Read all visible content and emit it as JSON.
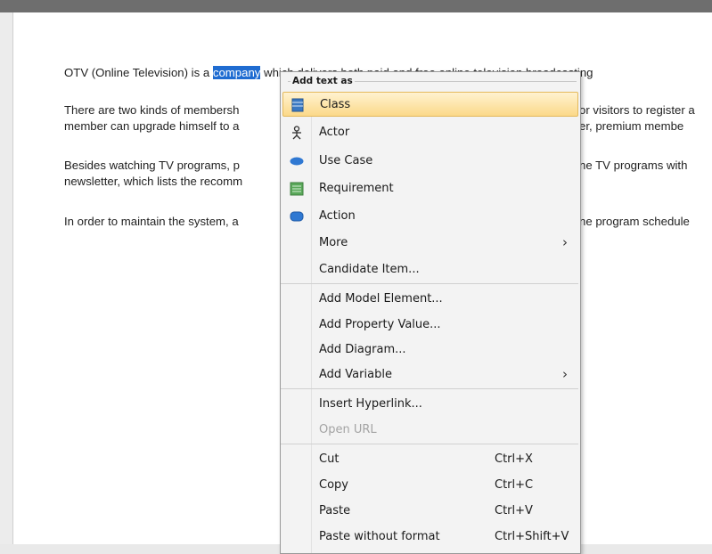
{
  "document": {
    "paragraphs": [
      {
        "lines": [
          "OTV (Online Television) is a ",
          "company",
          " which delivers both paid and free online television broadcasting"
        ]
      },
      {
        "lines": [
          "There are two kinds of membersh",
          "or visitors to register a",
          "member can upgrade himself to a",
          "er, premium membe"
        ]
      },
      {
        "lines": [
          "Besides watching TV programs, p",
          "ne TV programs with",
          "newsletter, which lists the recomm"
        ]
      },
      {
        "lines": [
          "In order to maintain the system, a",
          "ne program schedule"
        ]
      }
    ]
  },
  "menu": {
    "header": "Add text as",
    "items": [
      {
        "label": "Class",
        "icon": "class-icon"
      },
      {
        "label": "Actor",
        "icon": "actor-icon"
      },
      {
        "label": "Use Case",
        "icon": "use-case-icon"
      },
      {
        "label": "Requirement",
        "icon": "requirement-icon"
      },
      {
        "label": "Action",
        "icon": "action-icon"
      },
      {
        "label": "More",
        "submenu": true
      },
      {
        "label": "Candidate Item..."
      },
      {
        "label": "Add Model Element..."
      },
      {
        "label": "Add Property Value..."
      },
      {
        "label": "Add Diagram..."
      },
      {
        "label": "Add Variable",
        "submenu": true
      },
      {
        "label": "Insert Hyperlink..."
      },
      {
        "label": "Open URL",
        "disabled": true
      },
      {
        "label": "Cut",
        "shortcut": "Ctrl+X"
      },
      {
        "label": "Copy",
        "shortcut": "Ctrl+C"
      },
      {
        "label": "Paste",
        "shortcut": "Ctrl+V"
      },
      {
        "label": "Paste without format",
        "shortcut": "Ctrl+Shift+V"
      }
    ],
    "arrow": "›"
  },
  "colors": {
    "selection": "#1f6cd1",
    "highlight": "#fbd989",
    "class_icon": "#3a78c2",
    "requirement_icon": "#5aa85a"
  }
}
